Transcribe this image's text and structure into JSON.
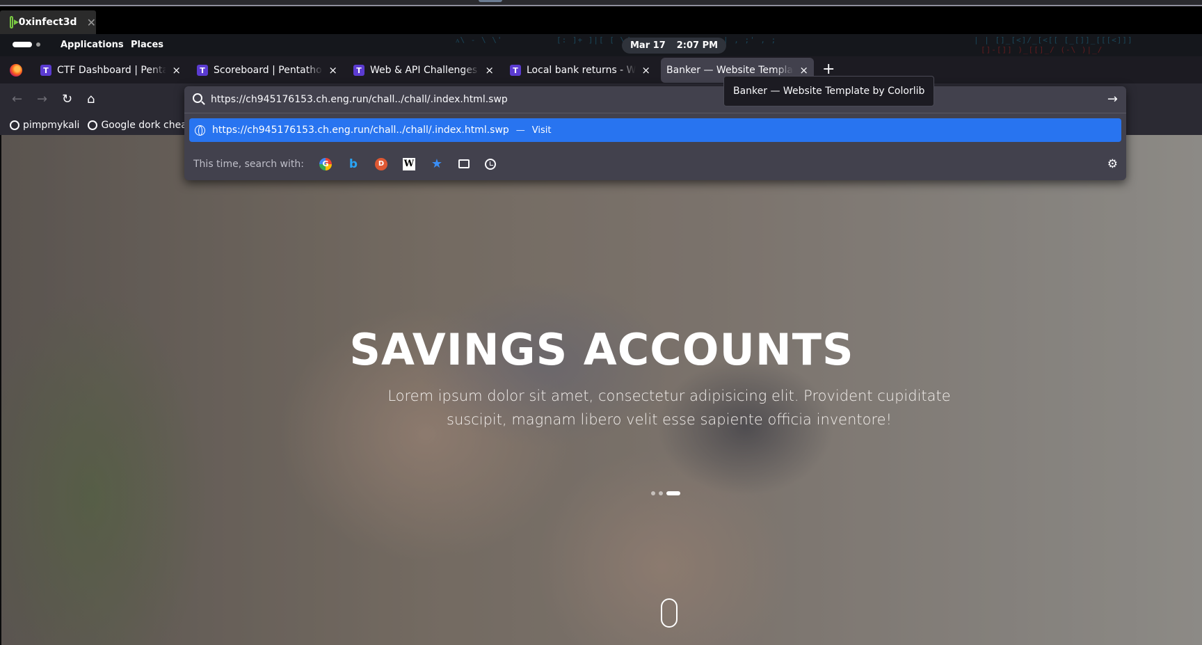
{
  "vm_window": {
    "tab_label": "0xinfect3d",
    "close_glyph": "✕"
  },
  "gnome": {
    "menus": [
      "Applications",
      "Places"
    ],
    "date": "Mar 17",
    "time": "2:07 PM",
    "matrix_text": [
      "ᴧ\\ - \\ \\'",
      "[: ]+ ]|[ [ \\/ ;",
      "| ,   ;'  ,  ;",
      "| |  []_[<]/_[<[[  [_[]]_[[[<]]] ",
      "[]-[]] )_[[]_/ (-\\ )|_/"
    ]
  },
  "browser": {
    "tabs": [
      {
        "title": "CTF Dashboard | Pentathon",
        "favicon": "T",
        "active": false
      },
      {
        "title": "Scoreboard | Pentathon CTF",
        "favicon": "T",
        "active": false
      },
      {
        "title": "Web & API Challenges | Pentathon",
        "favicon": "T",
        "active": false
      },
      {
        "title": "Local bank returns - Web",
        "favicon": "T",
        "active": false
      },
      {
        "title": "Banker — Website Template by Colorlib",
        "favicon": "",
        "active": true
      }
    ],
    "tab_close_glyph": "×",
    "new_tab_glyph": "+",
    "tooltip": "Banker — Website Template by Colorlib",
    "nav": {
      "back": "←",
      "forward": "→",
      "reload": "↻",
      "home": "⌂"
    },
    "bookmarks": [
      {
        "label": "pimpmykali",
        "icon": "github-icon"
      },
      {
        "label": "Google dork cheatsheet",
        "icon": "github-icon"
      }
    ],
    "urlbar": {
      "value": "https://ch945176153.ch.eng.run/chall../chall/.index.html.swp",
      "go_glyph": "→",
      "suggestion": {
        "url": "https://ch945176153.ch.eng.run/chall../chall/.index.html.swp",
        "dash": "—",
        "action": "Visit"
      },
      "search_with_label": "This time, search with:",
      "engines": [
        "google-icon",
        "bing-icon",
        "duckduckgo-icon",
        "wikipedia-icon",
        "bookmarks-icon",
        "tabs-icon",
        "history-icon"
      ],
      "engine_glyphs": {
        "google": "G",
        "bing": "b",
        "ddg": "D",
        "wiki": "W",
        "bookmarks": "★"
      },
      "settings_glyph": "⚙"
    }
  },
  "page": {
    "hero_title": "SAVINGS ACCOUNTS",
    "hero_subtitle": "Lorem ipsum dolor sit amet, consectetur adipisicing elit. Provident cupiditate suscipit, magnam libero velit esse sapiente officia inventore!",
    "carousel": {
      "slides": 3,
      "active_index": 2
    }
  }
}
